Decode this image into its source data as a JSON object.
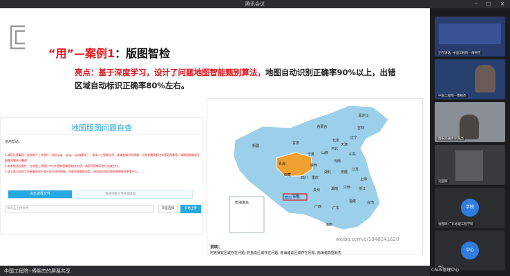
{
  "window": {
    "title": "腾讯会议"
  },
  "slide": {
    "title_prefix": "“用”—案例1",
    "title_suffix": "：版图智检",
    "highlight_prefix": "亮点：基于深度学习，设计了问题地图智能甄别算法，",
    "highlight_suffix": "地图自动识别正确率90%以上，出错区域自动标识正确率80%左右。"
  },
  "panel": {
    "title": "地图版图问题自查",
    "label": "使用帮助：",
    "tips": [
      "1.请您注意事项：仅限用户上传图片（包括.jpg、.png、.jpeg格式），采用人工智能技术，查询准确识别图像，识别准确率超过非规范图像率，请按照准确标注图像问题进行整改，",
      "2.本系统适应条件：在地图上传图片中为中国地图版图相关内容，请您可视情况进行自查工作。",
      "3.该工具为科技工作者服务化不表示任何法律依据。如有地图审核业务，请咨询自然资源部地图技术审查中心。"
    ],
    "upload_button": "点击选择文件",
    "upload_hint": "请将地图文件拖到此处",
    "search_placeholder": "请点击上传文件",
    "browse_button": "浏览选择",
    "start_button": "开始上传"
  },
  "map": {
    "regions": [
      "黑龙江",
      "吉林",
      "辽宁",
      "内蒙古",
      "北京",
      "天津",
      "河北",
      "山西",
      "陕西",
      "宁夏",
      "甘肃",
      "新疆",
      "青海",
      "西藏",
      "四川",
      "重庆",
      "湖北",
      "河南",
      "山东",
      "江苏",
      "安徽",
      "上海",
      "浙江",
      "江西",
      "湖南",
      "贵州",
      "云南",
      "广西",
      "广东",
      "福建",
      "台湾",
      "海南"
    ],
    "inset_label": "南海诸岛",
    "error_label": "藏南 不明",
    "watermark": "weibo.com/u/1948241620",
    "caption_label": "说明：",
    "caption": "阿克赛钦区域存在问题; 钓鱼岛区域存在问题; 南海诸岛区域存在问题; 南海诸岛框缺失"
  },
  "bottom": {
    "share_label": "中国工程院--傅熙杰的屏幕共享"
  },
  "participants": [
    {
      "name": "正在讲话: 中国工程院—傅熙杰"
    },
    {
      "name": "中国工程院—傅熙杰"
    },
    {
      "name": "西安交通大学 陈华"
    },
    {
      "name": "刘亚辉"
    },
    {
      "name": "张嘉玮 广东地理工程学院",
      "avatar": "学院"
    },
    {
      "name": "中心",
      "avatar": "中心"
    }
  ],
  "tray": {
    "label": "CAUS管理中心"
  },
  "colors": {
    "accent_red": "#e0141e",
    "accent_blue": "#27a9e1",
    "map_sea": "#cfe8f5",
    "map_land": "#9ccfe9",
    "tibet": "#f0a030"
  }
}
